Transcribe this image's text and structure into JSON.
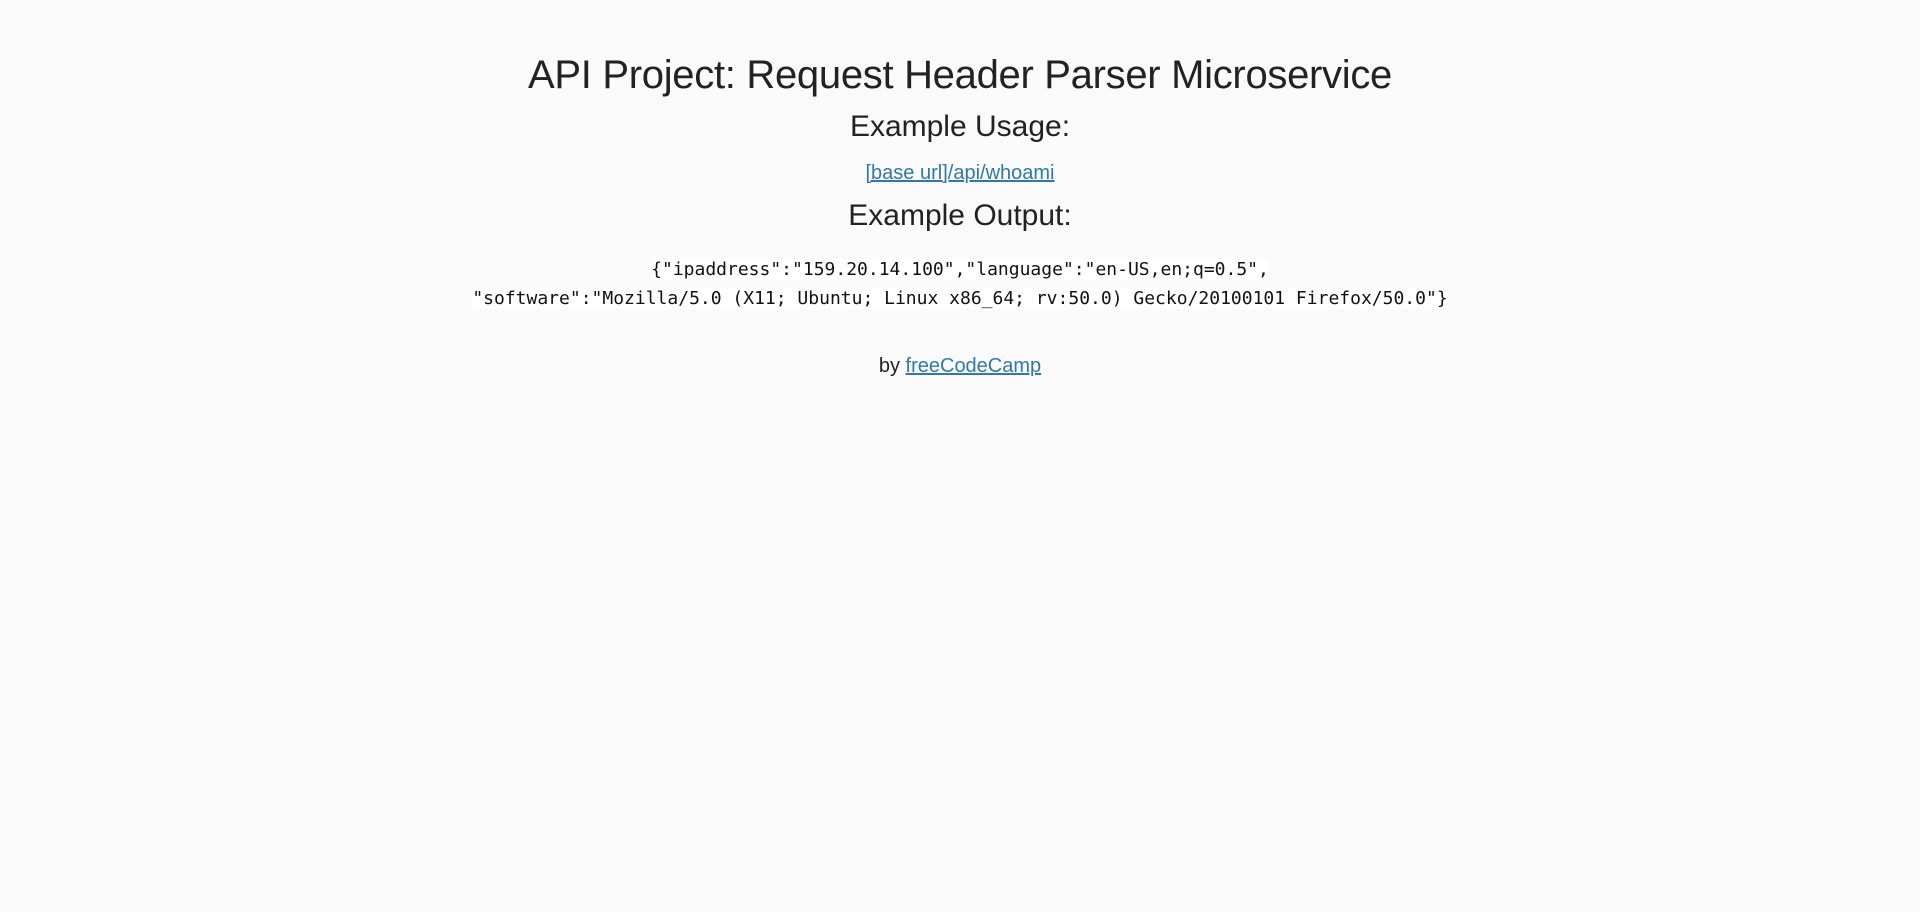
{
  "header": {
    "title": "API Project: Request Header Parser Microservice"
  },
  "usage": {
    "heading": "Example Usage:",
    "link_text": "[base url]/api/whoami"
  },
  "output": {
    "heading": "Example Output:",
    "line1": "{\"ipaddress\":\"159.20.14.100\",\"language\":\"en-US,en;q=0.5\",",
    "line2": "\"software\":\"Mozilla/5.0 (X11; Ubuntu; Linux x86_64; rv:50.0) Gecko/20100101 Firefox/50.0\"}"
  },
  "footer": {
    "prefix": "by",
    "link_text": "freeCodeCamp"
  },
  "colors": {
    "background": "#fafafa",
    "text": "#222222",
    "link": "#2f79a8",
    "code_background": "#ffffff"
  }
}
